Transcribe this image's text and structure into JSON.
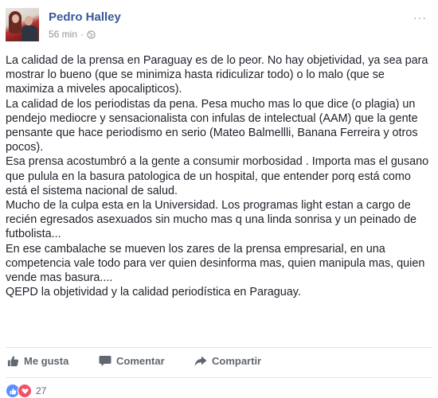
{
  "post": {
    "author": "Pedro Halley",
    "time": "56 min",
    "separator": "·",
    "privacy_icon": "globe-icon",
    "more_icon": "more-options-icon",
    "paragraphs": [
      "La calidad de la prensa en Paraguay es de lo peor. No hay objetividad, ya sea para mostrar lo bueno (que se minimiza hasta ridiculizar todo) o lo malo (que se maximiza a miveles apocalipticos).",
      "La calidad de los periodistas da pena. Pesa mucho mas lo que dice (o plagia) un pendejo mediocre y sensacionalista con infulas de intelectual (AAM) que la gente pensante que hace periodismo en serio (Mateo Balmellli, Banana Ferreira y otros pocos).",
      "Esa prensa acostumbró a la gente a consumir morbosidad . Importa mas el gusano que pulula en la basura patologica de un hospital, que entender porq está como está el sistema nacional de salud.",
      "Mucho de la culpa esta en la Universidad. Los programas light estan a cargo de recién egresados asexuados sin mucho mas q una linda sonrisa y un peinado de futbolista...",
      "En ese cambalache se mueven los zares de la prensa empresarial, en una competencia vale todo para ver quien desinforma mas, quien manipula mas, quien vende mas basura....",
      "QEPD la objetividad y la calidad periodística en Paraguay."
    ]
  },
  "actions": {
    "like_label": "Me gusta",
    "comment_label": "Comentar",
    "share_label": "Compartir"
  },
  "reactions": {
    "count": "27",
    "types": [
      "like-icon",
      "love-icon"
    ]
  },
  "colors": {
    "author": "#365899",
    "text": "#1d2129",
    "muted": "#90949c",
    "action": "#606770",
    "like": "#5890ff",
    "love": "#f25268"
  }
}
